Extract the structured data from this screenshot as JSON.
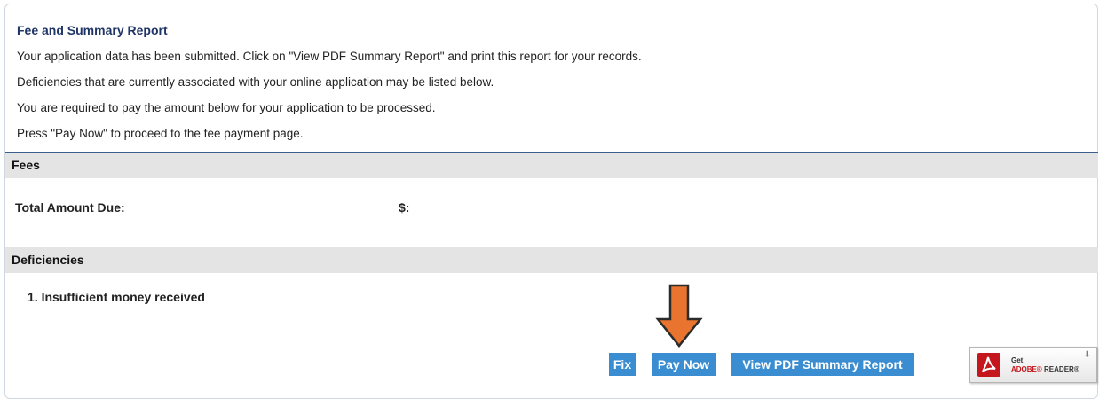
{
  "intro": {
    "title": "Fee and Summary Report",
    "lines": [
      "Your application data has been submitted. Click on \"View PDF Summary Report\" and print this report for your records.",
      "Deficiencies that are currently associated with your online application may be listed below.",
      "You are required to pay the amount below for your application to be processed.",
      "Press \"Pay Now\" to proceed to the fee payment page."
    ]
  },
  "fees": {
    "header": "Fees",
    "total_label": "Total Amount Due:",
    "total_value": "$:"
  },
  "deficiencies": {
    "header": "Deficiencies",
    "items": [
      "1. Insufficient money received"
    ]
  },
  "actions": {
    "fix_label": "Fix",
    "pay_now_label": "Pay Now",
    "pdf_label": "View PDF Summary Report"
  },
  "adobe_badge": {
    "get_text": "Get",
    "brand_text": "ADOBE®",
    "reader_text": "READER®",
    "icon": "adobe-pdf-icon"
  },
  "colors": {
    "button_bg": "#3a8dd1",
    "arrow_fill": "#e8742f",
    "title_color": "#1f3566",
    "section_bg": "#e4e4e4",
    "divider": "#3c5f8f"
  }
}
